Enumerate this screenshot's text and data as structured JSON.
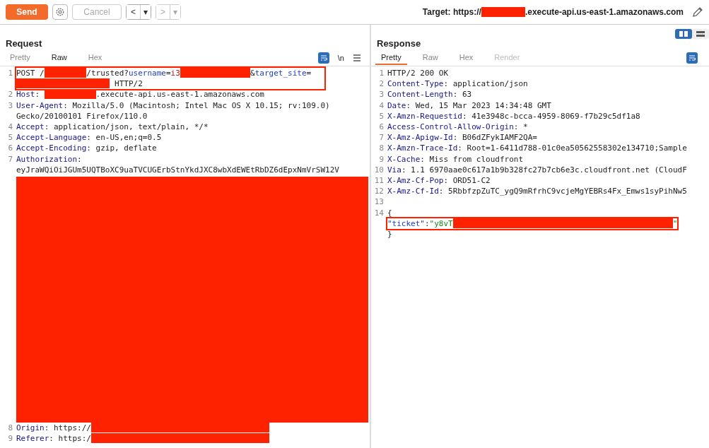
{
  "toolbar": {
    "send": "Send",
    "cancel": {
      "label": "Cancel",
      "disabled": true
    },
    "back": {
      "label": "<",
      "dropdown": "▾",
      "disabled": false
    },
    "forward": {
      "label": ">",
      "dropdown": "▾",
      "disabled": true
    },
    "target": {
      "prefix": "Target: https://",
      "suffix": ".execute-api.us-east-1.amazonaws.com"
    }
  },
  "view_toggle": [
    {
      "kind": "columns",
      "selected": true
    },
    {
      "kind": "rows",
      "selected": false
    }
  ],
  "request": {
    "title": "Request",
    "focused": false,
    "tabs": [
      {
        "label": "Pretty",
        "selected": false,
        "disabled": false
      },
      {
        "label": "Raw",
        "selected": true,
        "disabled": false
      },
      {
        "label": "Hex",
        "selected": false,
        "disabled": false
      }
    ],
    "newline_toggle": "\\n",
    "lines": [
      {
        "num": "1",
        "boxed": true,
        "rows": [
          [
            {
              "kind": "plain",
              "text": "POST /"
            },
            {
              "kind": "redacted"
            },
            {
              "kind": "plain",
              "text": "/trusted?"
            },
            {
              "kind": "param",
              "text": "username"
            },
            {
              "kind": "plain",
              "text": "="
            },
            {
              "kind": "value",
              "text": "i3"
            },
            {
              "kind": "redacted"
            },
            {
              "kind": "plain",
              "text": "&"
            },
            {
              "kind": "param",
              "text": "target_site"
            },
            {
              "kind": "plain",
              "text": "="
            }
          ],
          [
            {
              "kind": "redacted"
            },
            {
              "kind": "plain",
              "text": " HTTP/2"
            }
          ]
        ]
      },
      {
        "num": "2",
        "boxed": false,
        "rows": [
          [
            {
              "kind": "header",
              "text": "Host"
            },
            {
              "kind": "plain",
              "text": ": "
            },
            {
              "kind": "redacted"
            },
            {
              "kind": "plain",
              "text": ".execute-api.us-east-1.amazonaws.com"
            }
          ]
        ]
      },
      {
        "num": "3",
        "boxed": false,
        "rows": [
          [
            {
              "kind": "header",
              "text": "User-Agent"
            },
            {
              "kind": "plain",
              "text": ": Mozilla/5.0 (Macintosh; Intel Mac OS X 10.15; rv:109.0)"
            }
          ],
          [
            {
              "kind": "plain",
              "text": "Gecko/20100101 Firefox/110.0"
            }
          ]
        ]
      },
      {
        "num": "4",
        "boxed": false,
        "rows": [
          [
            {
              "kind": "header",
              "text": "Accept"
            },
            {
              "kind": "plain",
              "text": ": application/json, text/plain, */*"
            }
          ]
        ]
      },
      {
        "num": "5",
        "boxed": false,
        "rows": [
          [
            {
              "kind": "header",
              "text": "Accept-Language"
            },
            {
              "kind": "plain",
              "text": ": en-US,en;q=0.5"
            }
          ]
        ]
      },
      {
        "num": "6",
        "boxed": false,
        "rows": [
          [
            {
              "kind": "header",
              "text": "Accept-Encoding"
            },
            {
              "kind": "plain",
              "text": ": gzip, deflate"
            }
          ]
        ]
      },
      {
        "num": "7",
        "boxed": false,
        "rows": [
          [
            {
              "kind": "header",
              "text": "Authorization"
            },
            {
              "kind": "plain",
              "text": ":"
            }
          ],
          [
            {
              "kind": "plain",
              "text": "eyJraWQiOiJGUm5UQTBoXC9uaTVCUGErbStnYkdJXC8wbXdEWEtRbDZ6dEpxNmVrSW12V"
            }
          ],
          [
            {
              "kind": "block"
            }
          ]
        ]
      },
      {
        "num": "8",
        "boxed": false,
        "rows": [
          [
            {
              "kind": "header",
              "text": "Origin"
            },
            {
              "kind": "plain",
              "text": ": https://"
            },
            {
              "kind": "redacted"
            }
          ]
        ]
      },
      {
        "num": "9",
        "boxed": false,
        "rows": [
          [
            {
              "kind": "header",
              "text": "Referer"
            },
            {
              "kind": "plain",
              "text": ": https:/"
            },
            {
              "kind": "redacted"
            }
          ]
        ]
      }
    ]
  },
  "response": {
    "title": "Response",
    "focused": true,
    "tabs": [
      {
        "label": "Pretty",
        "selected": true,
        "disabled": false
      },
      {
        "label": "Raw",
        "selected": false,
        "disabled": false
      },
      {
        "label": "Hex",
        "selected": false,
        "disabled": false
      },
      {
        "label": "Render",
        "selected": false,
        "disabled": true
      }
    ],
    "lines": [
      {
        "num": "1",
        "boxed": false,
        "rows": [
          [
            {
              "kind": "plain",
              "text": "HTTP/2 200 OK"
            }
          ]
        ]
      },
      {
        "num": "2",
        "boxed": false,
        "rows": [
          [
            {
              "kind": "header",
              "text": "Content-Type"
            },
            {
              "kind": "plain",
              "text": ": application/json"
            }
          ]
        ]
      },
      {
        "num": "3",
        "boxed": false,
        "rows": [
          [
            {
              "kind": "header",
              "text": "Content-Length"
            },
            {
              "kind": "plain",
              "text": ": 63"
            }
          ]
        ]
      },
      {
        "num": "4",
        "boxed": false,
        "rows": [
          [
            {
              "kind": "header",
              "text": "Date"
            },
            {
              "kind": "plain",
              "text": ": Wed, 15 Mar 2023 14:34:48 GMT"
            }
          ]
        ]
      },
      {
        "num": "5",
        "boxed": false,
        "rows": [
          [
            {
              "kind": "header",
              "text": "X-Amzn-Requestid"
            },
            {
              "kind": "plain",
              "text": ": 41e3948c-bcca-4959-8069-f7b29c5df1a8"
            }
          ]
        ]
      },
      {
        "num": "6",
        "boxed": false,
        "rows": [
          [
            {
              "kind": "header",
              "text": "Access-Control-Allow-Origin"
            },
            {
              "kind": "plain",
              "text": ": *"
            }
          ]
        ]
      },
      {
        "num": "7",
        "boxed": false,
        "rows": [
          [
            {
              "kind": "header",
              "text": "X-Amz-Apigw-Id"
            },
            {
              "kind": "plain",
              "text": ": B06dZFykIAMF2QA="
            }
          ]
        ]
      },
      {
        "num": "8",
        "boxed": false,
        "rows": [
          [
            {
              "kind": "header",
              "text": "X-Amzn-Trace-Id"
            },
            {
              "kind": "plain",
              "text": ": Root=1-6411d788-01c0ea50562558302e134710;Sample"
            }
          ]
        ]
      },
      {
        "num": "9",
        "boxed": false,
        "rows": [
          [
            {
              "kind": "header",
              "text": "X-Cache"
            },
            {
              "kind": "plain",
              "text": ": Miss from cloudfront"
            }
          ]
        ]
      },
      {
        "num": "10",
        "boxed": false,
        "rows": [
          [
            {
              "kind": "header",
              "text": "Via"
            },
            {
              "kind": "plain",
              "text": ": 1.1 6970aae0c617a1b9b328fc27b7cb6e3c.cloudfront.net (CloudF"
            }
          ]
        ]
      },
      {
        "num": "11",
        "boxed": false,
        "rows": [
          [
            {
              "kind": "header",
              "text": "X-Amz-Cf-Pop"
            },
            {
              "kind": "plain",
              "text": ": ORD51-C2"
            }
          ]
        ]
      },
      {
        "num": "12",
        "boxed": false,
        "rows": [
          [
            {
              "kind": "header",
              "text": "X-Amz-Cf-Id"
            },
            {
              "kind": "plain",
              "text": ": 5RbbfzpZuTC_ygQ9mRfrhC9vcjeMgYEBRs4Fx_Emws1syPihNw5"
            }
          ]
        ]
      },
      {
        "num": "13",
        "boxed": false,
        "rows": [
          []
        ]
      },
      {
        "num": "14",
        "boxed": false,
        "rows": [
          [
            {
              "kind": "plain",
              "text": "{"
            }
          ]
        ]
      },
      {
        "boxed": true,
        "rows": [
          [
            {
              "kind": "json-key",
              "text": "\"ticket\""
            },
            {
              "kind": "plain",
              "text": ":"
            },
            {
              "kind": "json-string",
              "text": "\"y8vT"
            },
            {
              "kind": "redacted"
            },
            {
              "kind": "json-string",
              "text": "\""
            }
          ]
        ]
      },
      {
        "boxed": false,
        "rows": [
          [
            {
              "kind": "plain",
              "text": "}"
            }
          ]
        ]
      }
    ]
  }
}
